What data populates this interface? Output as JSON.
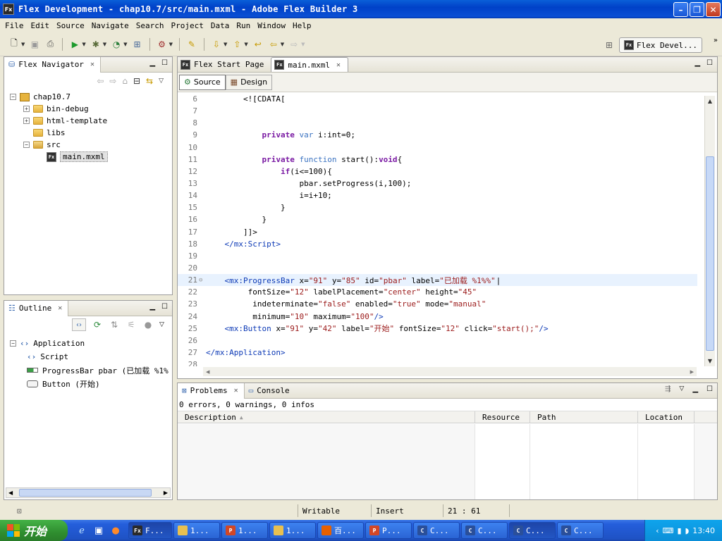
{
  "window": {
    "title": "Flex Development - chap10.7/src/main.mxml - Adobe Flex Builder 3",
    "app_icon": "Fx",
    "controls": [
      "minimize",
      "restore",
      "close"
    ]
  },
  "menu": [
    "File",
    "Edit",
    "Source",
    "Navigate",
    "Search",
    "Project",
    "Data",
    "Run",
    "Window",
    "Help"
  ],
  "perspective": {
    "label": "Flex Devel..."
  },
  "navigator": {
    "tab_label": "Flex Navigator",
    "tree": [
      {
        "label": "chap10.7",
        "depth": 0,
        "expander": "-",
        "icon": "project-icon"
      },
      {
        "label": "bin-debug",
        "depth": 1,
        "expander": "+",
        "icon": "folder-icon"
      },
      {
        "label": "html-template",
        "depth": 1,
        "expander": "+",
        "icon": "folder-icon"
      },
      {
        "label": "libs",
        "depth": 1,
        "expander": "",
        "icon": "folder-icon"
      },
      {
        "label": "src",
        "depth": 1,
        "expander": "-",
        "icon": "package-folder-icon"
      },
      {
        "label": "main.mxml",
        "depth": 2,
        "expander": "",
        "icon": "mxml-file-icon",
        "selected": true
      }
    ]
  },
  "outline": {
    "tab_label": "Outline",
    "tree": [
      {
        "label": "Application",
        "depth": 0,
        "expander": "-",
        "icon": "tag-icon"
      },
      {
        "label": "Script",
        "depth": 1,
        "icon": "tag-icon"
      },
      {
        "label": "ProgressBar pbar (已加载 %1%",
        "depth": 1,
        "icon": "progressbar-icon"
      },
      {
        "label": "Button (开始)",
        "depth": 1,
        "icon": "button-icon"
      }
    ]
  },
  "editor": {
    "tabs": [
      {
        "label": "Flex Start Page",
        "active": false
      },
      {
        "label": "main.mxml",
        "active": true
      }
    ],
    "modes": {
      "source": "Source",
      "design": "Design"
    },
    "lines": [
      {
        "n": "6",
        "parts": [
          [
            "plain",
            "        <![CDATA["
          ]
        ]
      },
      {
        "n": "7",
        "parts": []
      },
      {
        "n": "8",
        "parts": []
      },
      {
        "n": "9",
        "parts": [
          [
            "plain",
            "            "
          ],
          [
            "kw",
            "private"
          ],
          [
            "plain",
            " "
          ],
          [
            "kw2",
            "var"
          ],
          [
            "plain",
            " i:int=0;"
          ]
        ]
      },
      {
        "n": "10",
        "parts": []
      },
      {
        "n": "11",
        "parts": [
          [
            "plain",
            "            "
          ],
          [
            "kw",
            "private"
          ],
          [
            "plain",
            " "
          ],
          [
            "kw2",
            "function"
          ],
          [
            "plain",
            " start():"
          ],
          [
            "kw",
            "void"
          ],
          [
            "plain",
            "{"
          ]
        ]
      },
      {
        "n": "12",
        "parts": [
          [
            "plain",
            "                "
          ],
          [
            "kw",
            "if"
          ],
          [
            "plain",
            "(i<=100){"
          ]
        ]
      },
      {
        "n": "13",
        "parts": [
          [
            "plain",
            "                    pbar.setProgress(i,100);"
          ]
        ]
      },
      {
        "n": "14",
        "parts": [
          [
            "plain",
            "                    i=i+10;"
          ]
        ]
      },
      {
        "n": "15",
        "parts": [
          [
            "plain",
            "                }"
          ]
        ]
      },
      {
        "n": "16",
        "parts": [
          [
            "plain",
            "            }"
          ]
        ]
      },
      {
        "n": "17",
        "parts": [
          [
            "plain",
            "        ]]>"
          ]
        ]
      },
      {
        "n": "18",
        "parts": [
          [
            "plain",
            "    "
          ],
          [
            "tag",
            "</mx:Script>"
          ]
        ]
      },
      {
        "n": "19",
        "parts": []
      },
      {
        "n": "20",
        "parts": []
      },
      {
        "n": "21",
        "fold": "⊖",
        "current": true,
        "parts": [
          [
            "plain",
            "    "
          ],
          [
            "tag",
            "<mx:ProgressBar"
          ],
          [
            "attr",
            " x="
          ],
          [
            "val",
            "\"91\""
          ],
          [
            "attr",
            " y="
          ],
          [
            "val",
            "\"85\""
          ],
          [
            "attr",
            " id="
          ],
          [
            "val",
            "\"pbar\""
          ],
          [
            "attr",
            " label="
          ],
          [
            "val",
            "\"已加载 %1%%\""
          ]
        ]
      },
      {
        "n": "22",
        "parts": [
          [
            "attr",
            "         fontSize="
          ],
          [
            "val",
            "\"12\""
          ],
          [
            "attr",
            " labelPlacement="
          ],
          [
            "val",
            "\"center\""
          ],
          [
            "attr",
            " height="
          ],
          [
            "val",
            "\"45\""
          ]
        ]
      },
      {
        "n": "23",
        "parts": [
          [
            "attr",
            "          indeterminate="
          ],
          [
            "val",
            "\"false\""
          ],
          [
            "attr",
            " enabled="
          ],
          [
            "val",
            "\"true\""
          ],
          [
            "attr",
            " mode="
          ],
          [
            "val",
            "\"manual\""
          ]
        ]
      },
      {
        "n": "24",
        "parts": [
          [
            "attr",
            "          minimum="
          ],
          [
            "val",
            "\"10\""
          ],
          [
            "attr",
            " maximum="
          ],
          [
            "val",
            "\"100\""
          ],
          [
            "tag",
            "/>"
          ]
        ]
      },
      {
        "n": "25",
        "parts": [
          [
            "plain",
            "    "
          ],
          [
            "tag",
            "<mx:Button"
          ],
          [
            "attr",
            " x="
          ],
          [
            "val",
            "\"91\""
          ],
          [
            "attr",
            " y="
          ],
          [
            "val",
            "\"42\""
          ],
          [
            "attr",
            " label="
          ],
          [
            "val",
            "\"开始\""
          ],
          [
            "attr",
            " fontSize="
          ],
          [
            "val",
            "\"12\""
          ],
          [
            "attr",
            " click="
          ],
          [
            "val",
            "\"start();\""
          ],
          [
            "tag",
            "/>"
          ]
        ]
      },
      {
        "n": "26",
        "parts": []
      },
      {
        "n": "27",
        "parts": [
          [
            "tag",
            "</mx:Application>"
          ]
        ]
      },
      {
        "n": "28",
        "parts": []
      }
    ]
  },
  "problems": {
    "tabs": [
      {
        "label": "Problems",
        "active": true
      },
      {
        "label": "Console",
        "active": false
      }
    ],
    "summary": "0 errors, 0 warnings, 0 infos",
    "columns": [
      "Description",
      "Resource",
      "Path",
      "Location"
    ]
  },
  "status": {
    "writable": "Writable",
    "insert": "Insert",
    "position": "21 : 61"
  },
  "taskbar": {
    "start_label": "开始",
    "tasks": [
      {
        "label": "F...",
        "icon": "flex-icon",
        "active": true
      },
      {
        "label": "1...",
        "icon": "folder-icon"
      },
      {
        "label": "1...",
        "icon": "powerpoint-icon"
      },
      {
        "label": "1...",
        "icon": "folder-icon"
      },
      {
        "label": "百...",
        "icon": "firefox-icon"
      },
      {
        "label": "P...",
        "icon": "powerpoint-icon"
      },
      {
        "label": "C...",
        "icon": "app-icon"
      },
      {
        "label": "C...",
        "icon": "app-icon"
      },
      {
        "label": "C...",
        "icon": "app-icon",
        "active": true
      },
      {
        "label": "C...",
        "icon": "app-icon"
      }
    ],
    "clock": "13:40"
  },
  "colors": {
    "titlebar": "#0041c8",
    "tag": "#0d3ab6",
    "string": "#9b1a1a",
    "keyword": "#7a1aa3",
    "current_line": "#e8f2fe"
  }
}
